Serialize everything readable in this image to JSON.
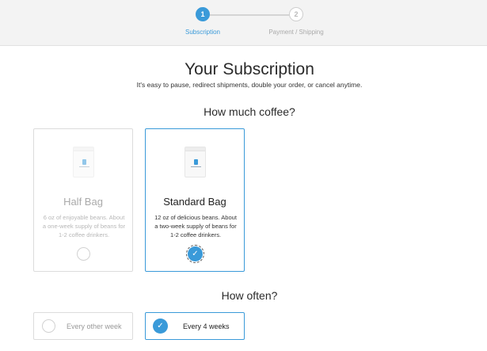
{
  "progress": {
    "steps": [
      {
        "number": "1",
        "label": "Subscription",
        "active": true
      },
      {
        "number": "2",
        "label": "Payment / Shipping",
        "active": false
      }
    ]
  },
  "header": {
    "title": "Your Subscription",
    "subtitle": "It's easy to pause, redirect shipments, double your order, or cancel anytime."
  },
  "amount": {
    "heading": "How much coffee?",
    "options": [
      {
        "name": "Half Bag",
        "description": "6 oz of enjoyable beans. About a one-week supply of beans for 1-2 coffee drinkers.",
        "selected": false
      },
      {
        "name": "Standard Bag",
        "description": "12 oz of delicious beans. About a two-week supply of beans for 1-2 coffee drinkers.",
        "selected": true
      }
    ]
  },
  "frequency": {
    "heading": "How often?",
    "options": [
      {
        "label": "Every other week",
        "selected": false
      },
      {
        "label": "Every 4 weeks",
        "selected": true
      }
    ]
  },
  "icons": {
    "check": "check-icon",
    "bag": "coffee-bag-icon"
  },
  "colors": {
    "accent": "#3a9ad9",
    "header_bg": "#f3f3f3",
    "muted_text": "#aaaaaa"
  }
}
